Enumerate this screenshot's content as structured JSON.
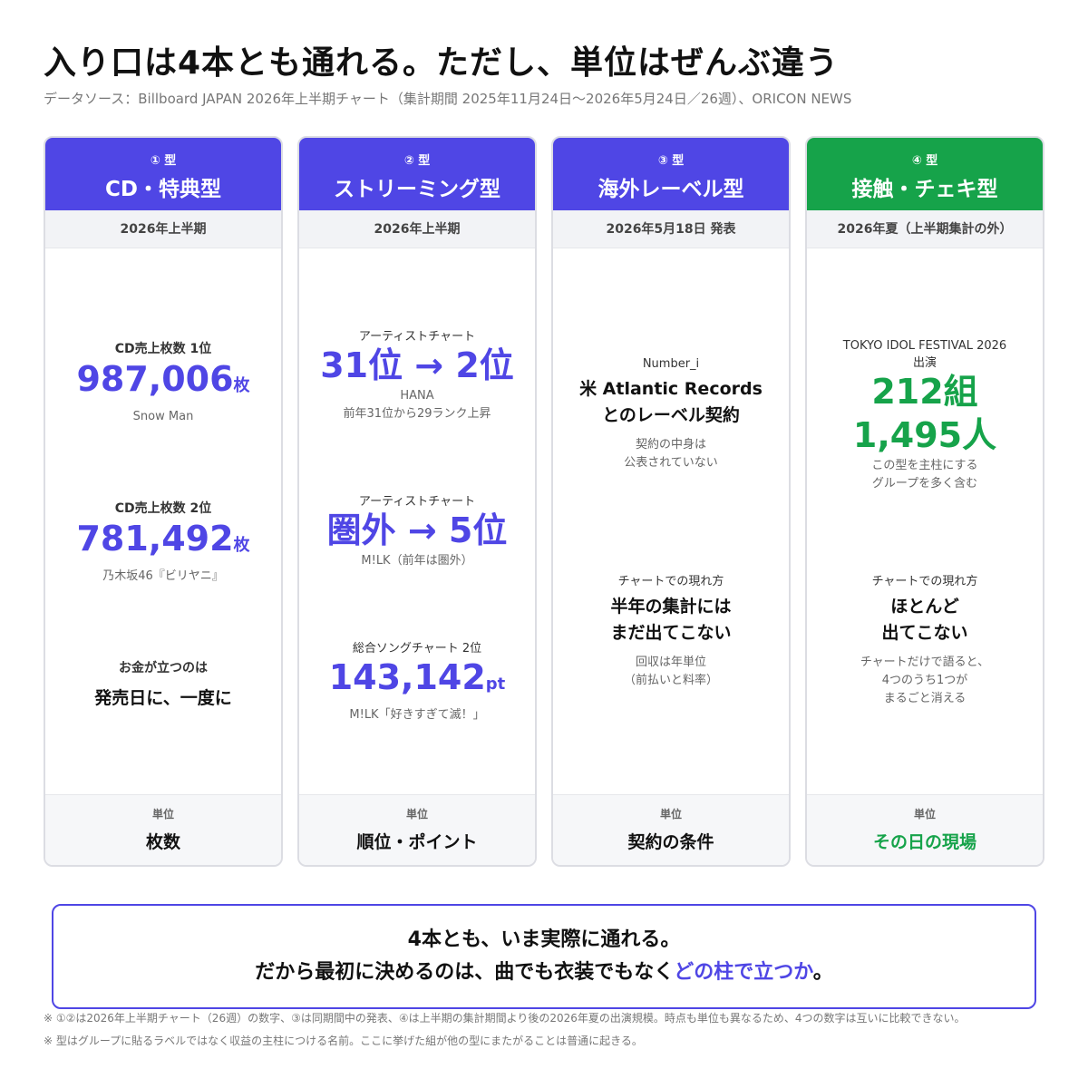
{
  "title": "入り口は4本とも通れる。ただし、単位はぜんぶ違う",
  "source": "データソース：Billboard JAPAN 2026年上半期チャート（集計期間 2025年11月24日〜2026年5月24日／26週）、ORICON NEWS",
  "colors": {
    "blue": "#4f46e5",
    "green": "#16a34a"
  },
  "columns": [
    {
      "num": "① 型",
      "name": "CD・特典型",
      "period": "2026年上半期",
      "b1": {
        "label": "CD売上枚数 1位",
        "value": "987,006",
        "unit": "枚",
        "sub": "Snow Man"
      },
      "b2": {
        "label": "CD売上枚数 2位",
        "value": "781,492",
        "unit": "枚",
        "sub": "乃木坂46『ビリヤニ』"
      },
      "b3": {
        "label": "お金が立つのは",
        "text": "発売日に、一度に"
      },
      "unit_label": "単位",
      "unit_value": "枚数"
    },
    {
      "num": "② 型",
      "name": "ストリーミング型",
      "period": "2026年上半期",
      "b1": {
        "label": "アーティストチャート",
        "value": "31位 → 2位",
        "sub1": "HANA",
        "sub2": "前年31位から29ランク上昇"
      },
      "b2": {
        "label": "アーティストチャート",
        "value": "圏外 → 5位",
        "sub": "M!LK（前年は圏外）"
      },
      "b3": {
        "label": "総合ソングチャート 2位",
        "value": "143,142",
        "unit": "pt",
        "sub": "M!LK「好きすぎて滅！」"
      },
      "unit_label": "単位",
      "unit_value": "順位・ポイント"
    },
    {
      "num": "③ 型",
      "name": "海外レーベル型",
      "period": "2026年5月18日 発表",
      "b1": {
        "label": "Number_i",
        "line1": "米 Atlantic Records",
        "line2": "とのレーベル契約",
        "sub1": "契約の中身は",
        "sub2": "公表されていない"
      },
      "b2": {
        "label": "チャートでの現れ方",
        "line1": "半年の集計には",
        "line2": "まだ出てこない",
        "sub1": "回収は年単位",
        "sub2": "（前払いと料率）"
      },
      "unit_label": "単位",
      "unit_value": "契約の条件"
    },
    {
      "num": "④ 型",
      "name": "接触・チェキ型",
      "period": "2026年夏（上半期集計の外）",
      "b1": {
        "label1": "TOKYO IDOL FESTIVAL 2026",
        "label2": "出演",
        "value1": "212組",
        "value2": "1,495人",
        "sub1": "この型を主柱にする",
        "sub2": "グループを多く含む"
      },
      "b2": {
        "label": "チャートでの現れ方",
        "line1": "ほとんど",
        "line2": "出てこない",
        "sub1": "チャートだけで語ると、",
        "sub2": "4つのうち1つが",
        "sub3": "まるごと消える"
      },
      "unit_label": "単位",
      "unit_value": "その日の現場"
    }
  ],
  "callout": {
    "line1": "4本とも、いま実際に通れる。",
    "line2_pre": "だから最初に決めるのは、曲でも衣装でもなく",
    "line2_accent": "どの柱で立つか",
    "line2_post": "。"
  },
  "notes": [
    "※ ①②は2026年上半期チャート（26週）の数字、③は同期間中の発表、④は上半期の集計期間より後の2026年夏の出演規模。時点も単位も異なるため、4つの数字は互いに比較できない。",
    "※ 型はグループに貼るラベルではなく収益の主柱につける名前。ここに挙げた組が他の型にまたがることは普通に起きる。"
  ]
}
